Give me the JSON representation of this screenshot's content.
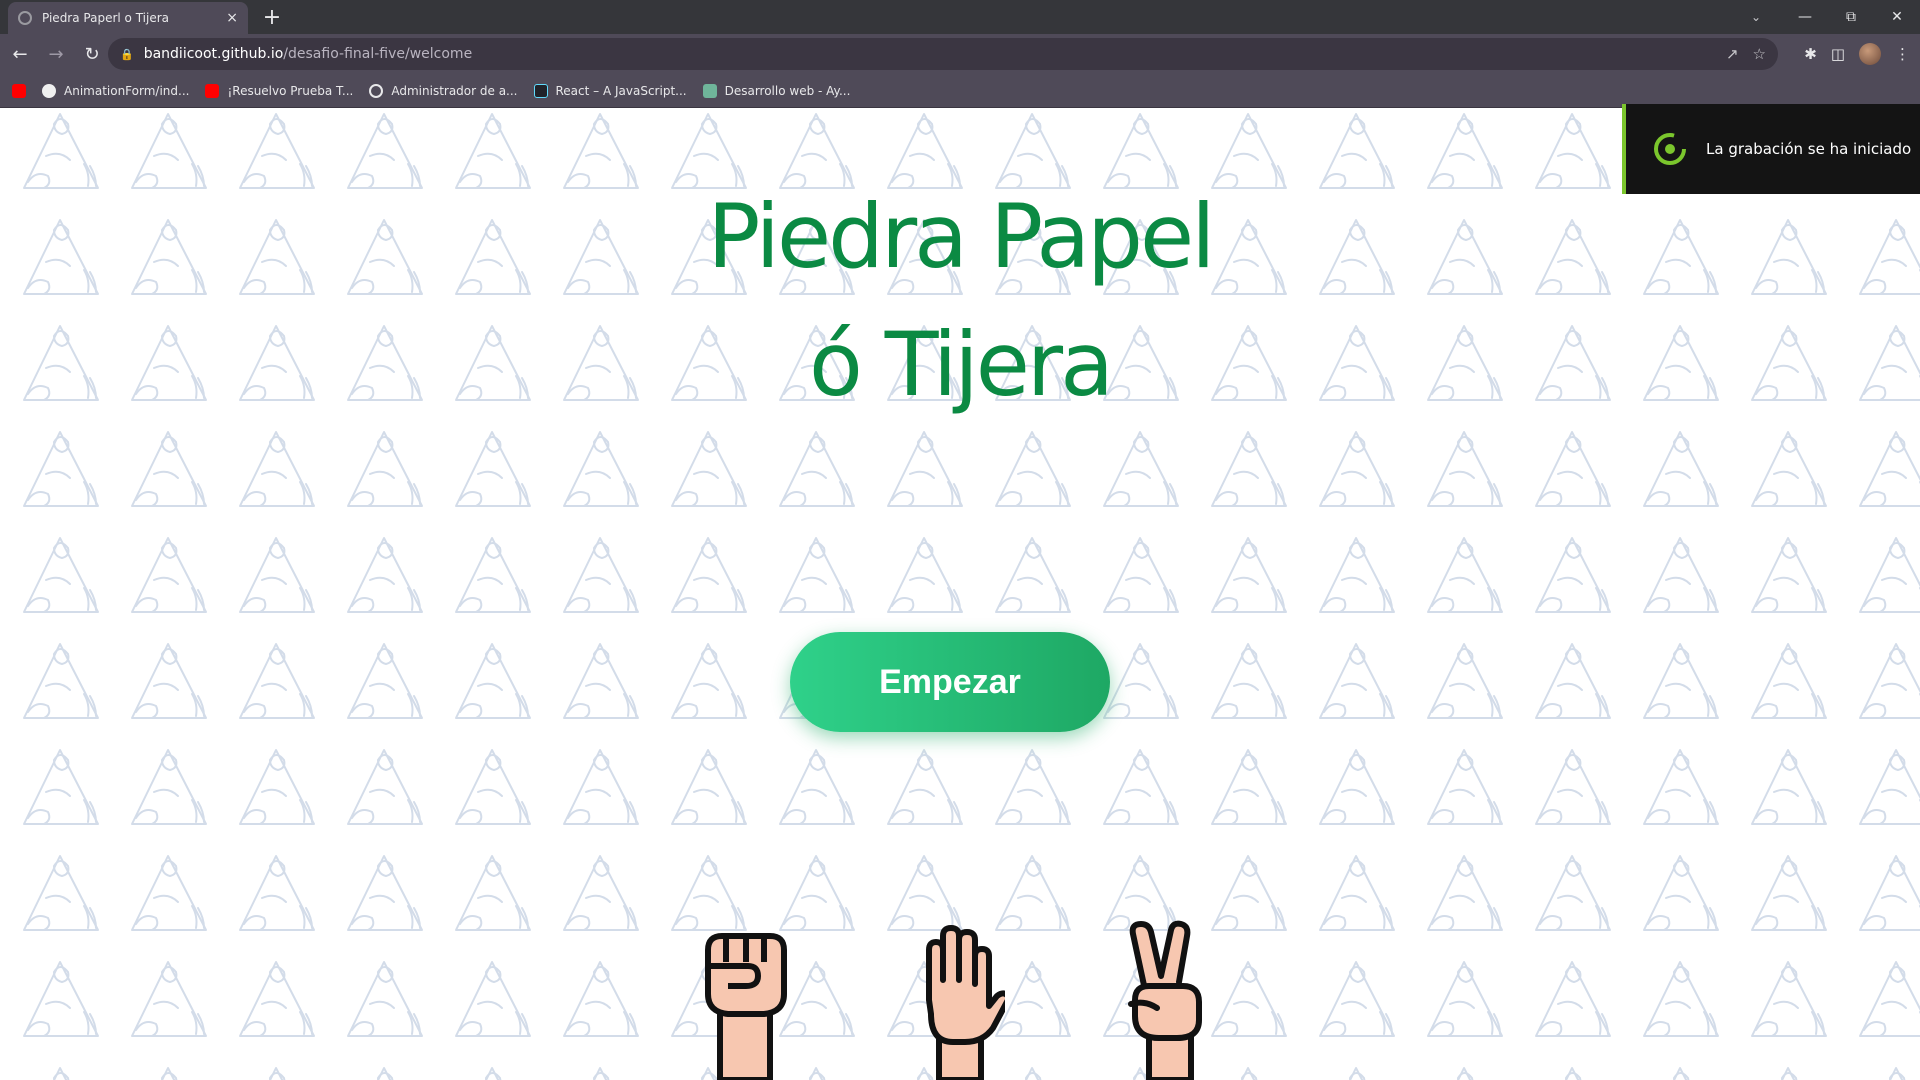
{
  "browser": {
    "tab_title": "Piedra Paperl o Tijera",
    "tab_close": "×",
    "new_tab": "+",
    "url_host": "bandiicoot.github.io",
    "url_path": "/desafio-final-five/welcome",
    "bookmarks": [
      {
        "label": "AnimationForm/ind...",
        "icon": "youtube-icon"
      },
      {
        "label": "¡Resuelvo Prueba T...",
        "icon": "youtube-icon"
      },
      {
        "label": "Administrador de a...",
        "icon": "wordpress-icon"
      },
      {
        "label": "React – A JavaScript...",
        "icon": "react-icon"
      },
      {
        "label": "Desarrollo web - Ay...",
        "icon": "web-icon"
      }
    ]
  },
  "notification": {
    "text": "La grabación se ha iniciado",
    "accent": "#7bc62d"
  },
  "page": {
    "title_line1": "Piedra Papel",
    "title_line2": "ó Tijera",
    "start_button": "Empezar",
    "title_color": "#0b8a43",
    "button_gradient": [
      "#2fd18a",
      "#1ea864"
    ],
    "hands": [
      "fist-icon",
      "open-hand-icon",
      "peace-hand-icon"
    ]
  }
}
